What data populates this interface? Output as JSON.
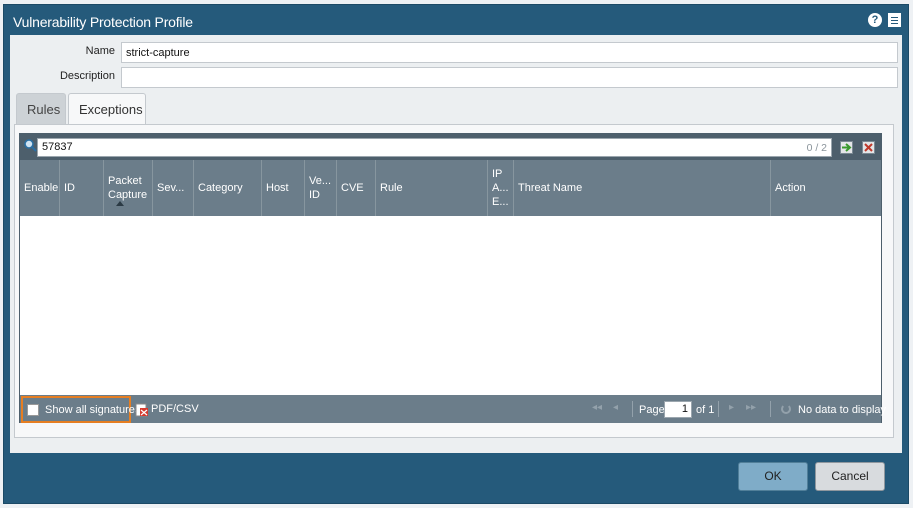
{
  "dialog": {
    "title": "Vulnerability Protection Profile",
    "help_icon": "question-circle-icon",
    "doc_icon": "document-icon"
  },
  "form": {
    "name_label": "Name",
    "name_value": "strict-capture",
    "description_label": "Description",
    "description_value": ""
  },
  "tabs": [
    {
      "label": "Rules",
      "active": false
    },
    {
      "label": "Exceptions",
      "active": true
    }
  ],
  "search": {
    "value": "57837",
    "count": "0 / 2",
    "search_icon": "magnifier-icon",
    "go_icon": "arrow-right-icon",
    "clear_icon": "clear-x-icon"
  },
  "columns": [
    "Enable",
    "ID",
    "Packet Capture",
    "Sev...",
    "Category",
    "Host",
    "Ve... ID",
    "CVE",
    "Rule",
    "IP A... E...",
    "Threat Name",
    "Action"
  ],
  "rows": [],
  "footer": {
    "show_all_label": "Show all signatures",
    "show_all_checked": false,
    "pdf_label": "PDF/CSV",
    "page_label": "Page",
    "page_value": "1",
    "of_label": "of 1",
    "status": "No data to display"
  },
  "buttons": {
    "ok": "OK",
    "cancel": "Cancel"
  },
  "colors": {
    "dialog_header": "#255a7b",
    "grid_header": "#6b7d8a",
    "highlight_border": "#e67e22",
    "ok_button": "#7facc8"
  }
}
